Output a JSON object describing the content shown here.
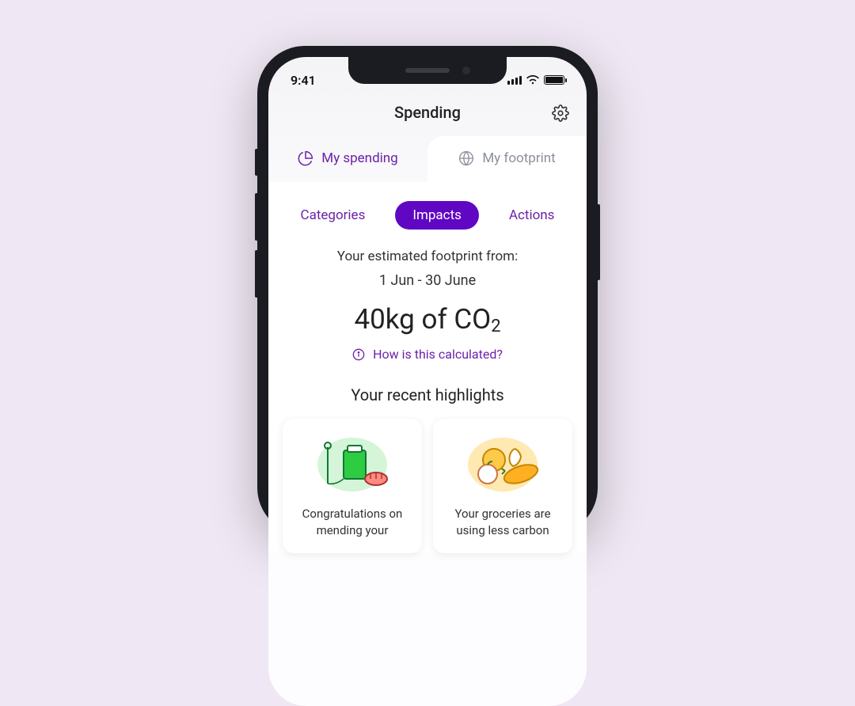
{
  "status": {
    "time": "9:41"
  },
  "header": {
    "title": "Spending"
  },
  "tabs": [
    {
      "label": "My spending",
      "active": false
    },
    {
      "label": "My footprint",
      "active": true
    }
  ],
  "pills": [
    {
      "label": "Categories",
      "active": false
    },
    {
      "label": "Impacts",
      "active": true
    },
    {
      "label": "Actions",
      "active": false
    }
  ],
  "footprint": {
    "intro": "Your estimated footprint from:",
    "date_range": "1 Jun - 30 June",
    "amount_prefix": "40kg of CO",
    "amount_sub": "2",
    "how_calc": "How is this calculated?"
  },
  "highlights": {
    "title": "Your recent highlights",
    "cards": [
      {
        "text": "Congratulations on mending your"
      },
      {
        "text": "Your groceries are using less carbon"
      }
    ]
  }
}
